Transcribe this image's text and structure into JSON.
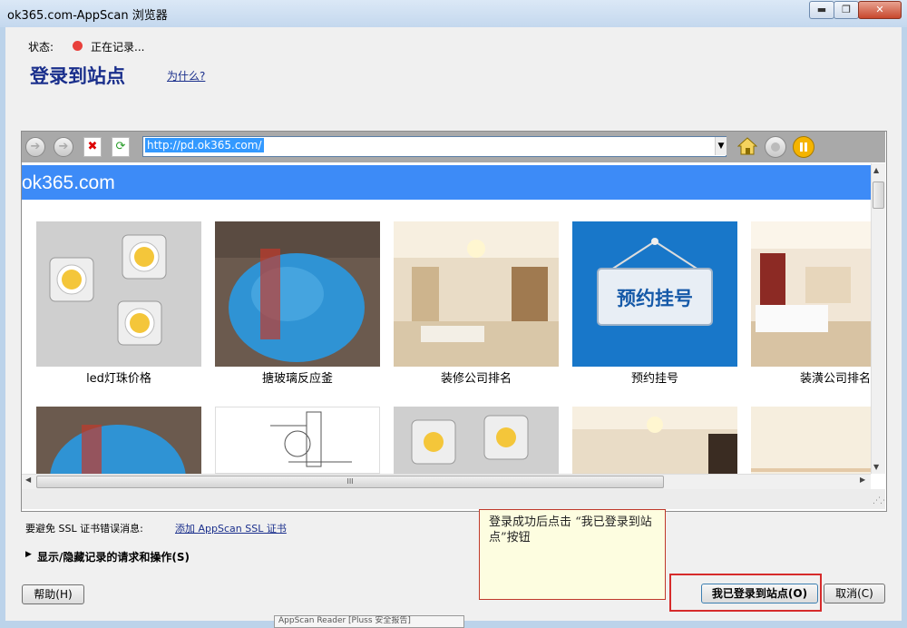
{
  "window": {
    "title": "ok365.com-AppScan 浏览器",
    "min_label": "▬",
    "max_label": "❐",
    "close_label": "✕"
  },
  "status": {
    "label": "状态:",
    "text": "正在记录..."
  },
  "heading": {
    "title": "登录到站点",
    "why_link": "为什么?"
  },
  "browser": {
    "url": "http://pd.ok365.com/",
    "site_title": "ok365.com",
    "products_row1": [
      {
        "caption": "led灯珠价格",
        "image": "led-chips-image"
      },
      {
        "caption": "搪玻璃反应釜",
        "image": "blue-reactor-image"
      },
      {
        "caption": "装修公司排名",
        "image": "living-room-image"
      },
      {
        "caption": "预约挂号",
        "image": "appointment-sign-image"
      },
      {
        "caption": "装潢公司排名",
        "image": "bedroom-image"
      }
    ],
    "appointment_sign_text": "预约挂号",
    "hscroll_grip": "III"
  },
  "ssl": {
    "label": "要避免 SSL 证书错误消息:",
    "link": "添加 AppScan SSL 证书"
  },
  "toggle": {
    "label": "显示/隐藏记录的请求和操作(S)"
  },
  "buttons": {
    "help": "帮助(H)",
    "logged_in": "我已登录到站点(O)",
    "cancel": "取消(C)"
  },
  "note": {
    "text": "登录成功后点击 “我已登录到站点”按钮"
  },
  "bottom_tab": {
    "text": "AppScan Reader [Pluss 安全报告]"
  },
  "colors": {
    "banner": "#3d8bf7",
    "heading": "#1a2f8c",
    "record_dot": "#e8403c",
    "highlight_border": "#d62b2b"
  }
}
